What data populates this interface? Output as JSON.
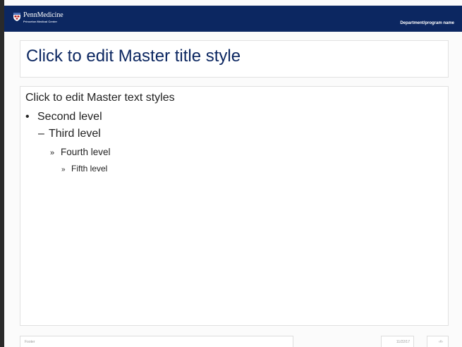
{
  "header": {
    "brand_name": "PennMedicine",
    "brand_subtitle": "Princeton Medical Center",
    "department": "Department/program name",
    "logo_icon": "shield-icon",
    "background_color": "#0c2761"
  },
  "title_placeholder": {
    "text": "Click to edit Master title style",
    "color": "#0c2761"
  },
  "body_placeholder": {
    "level1": "Click to edit Master text styles",
    "level2": {
      "bullet": "•",
      "text": "Second level"
    },
    "level3": {
      "bullet": "–",
      "text": "Third level"
    },
    "level4": {
      "bullet": "»",
      "text": "Fourth level"
    },
    "level5": {
      "bullet": "»",
      "text": "Fifth level"
    }
  },
  "footer": {
    "text": "Footer",
    "date": "11/22/17",
    "slide_number": "‹#›"
  }
}
